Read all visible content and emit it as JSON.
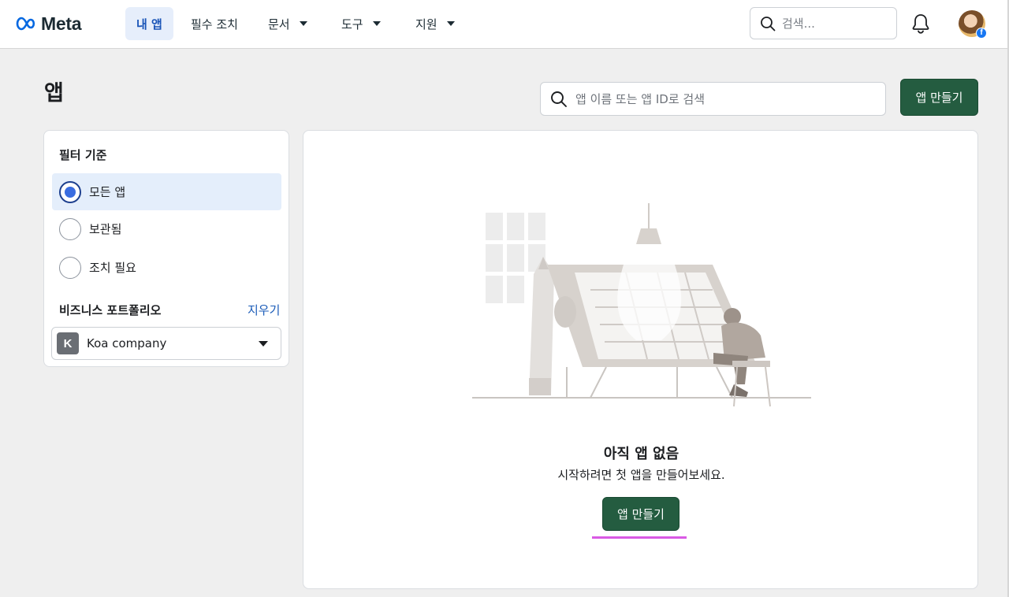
{
  "brand": {
    "name": "Meta"
  },
  "nav": {
    "items": [
      {
        "label": "내 앱",
        "active": true
      },
      {
        "label": "필수 조치",
        "has_dropdown": false
      },
      {
        "label": "문서",
        "has_dropdown": true
      },
      {
        "label": "도구",
        "has_dropdown": true
      },
      {
        "label": "지원",
        "has_dropdown": true
      }
    ],
    "search_placeholder": "검색..."
  },
  "page": {
    "title": "앱",
    "search_placeholder": "앱 이름 또는 앱 ID로 검색",
    "create_button": "앱 만들기"
  },
  "filter": {
    "heading": "필터 기준",
    "options": [
      {
        "label": "모든 앱",
        "selected": true
      },
      {
        "label": "보관됨",
        "selected": false
      },
      {
        "label": "조치 필요",
        "selected": false
      }
    ],
    "portfolio_label": "비즈니스 포트폴리오",
    "clear_label": "지우기",
    "business": {
      "initial": "K",
      "name": "Koa company"
    }
  },
  "empty_state": {
    "title": "아직 앱 없음",
    "description": "시작하려면 첫 앱을 만들어보세요.",
    "button": "앱 만들기"
  },
  "colors": {
    "primary_button": "#245c40",
    "nav_active_bg": "#e6eefb",
    "nav_active_text": "#1a55b8",
    "link": "#1a5bb8",
    "radio_selected": "#3a6de0",
    "focus_underline": "#d95ae4"
  }
}
